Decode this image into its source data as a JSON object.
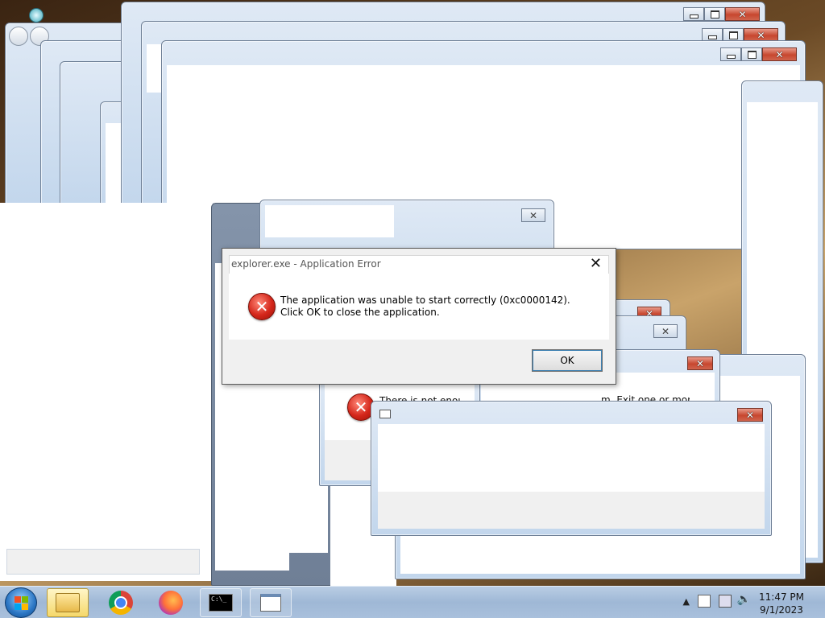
{
  "dialog": {
    "title": "explorer.exe - Application Error",
    "close_glyph": "✕",
    "message": "The application was unable to start correctly (0xc0000142). Click OK to close the application.",
    "ok_label": "OK",
    "icon": "error-icon"
  },
  "background_dialog": {
    "partial_message_left": "There is not enoug",
    "partial_message_right": "m. Exit one or more"
  },
  "taskbar": {
    "items": [
      {
        "name": "windows-explorer",
        "icon": "folder-icon"
      },
      {
        "name": "google-chrome",
        "icon": "chrome-icon"
      },
      {
        "name": "firefox",
        "icon": "firefox-icon"
      },
      {
        "name": "command-prompt",
        "icon": "cmd-icon",
        "glyph": "C:\\_"
      },
      {
        "name": "window-app",
        "icon": "app-window-icon"
      }
    ],
    "clock": {
      "time": "11:47 PM",
      "date": "9/1/2023"
    },
    "tray_icons": [
      "show-hidden-icons",
      "action-center-icon",
      "network-icon",
      "volume-icon"
    ]
  },
  "colors": {
    "close_button": "#c7472f",
    "error_icon": "#d4261a",
    "dialog_background": "#f0f0f0"
  }
}
